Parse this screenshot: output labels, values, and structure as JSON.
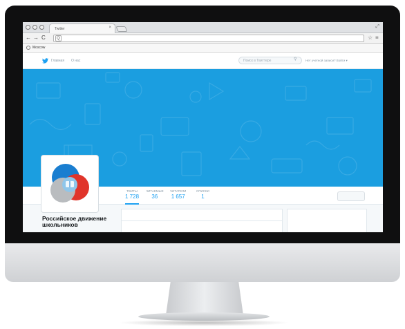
{
  "browser": {
    "tab_title": "Twitter",
    "tab_close": "×",
    "restore_glyph": "⤢",
    "nav": {
      "back": "←",
      "forward": "→",
      "reload": "C"
    },
    "omnibox_icon": "Q",
    "star": "☆",
    "menu": "≡",
    "bookmark_label": "Moscow"
  },
  "twitter": {
    "nav_home": "Главная",
    "nav_about": "О нас",
    "search_placeholder": "Поиск в Твиттере",
    "search_icon": "🔍",
    "login_prompt": "Нет учетной записи? Войти ▾",
    "brand_color": "#1da1f2",
    "banner_color": "#1b9ee0"
  },
  "profile": {
    "name": "Российское движение школьников",
    "stats": [
      {
        "label": "ТВИТЫ",
        "value": "1 728"
      },
      {
        "label": "ЧИТАЕМЫЕ",
        "value": "36"
      },
      {
        "label": "ЧИТАТЕЛИ",
        "value": "1 657"
      },
      {
        "label": "СПИСКИ",
        "value": "1"
      }
    ],
    "logo_colors": {
      "blue": "#1a7ed0",
      "red": "#e0342a",
      "grey": "#b9bcbf",
      "center": "#8fc6ea"
    }
  },
  "icons": {
    "bird": "twitter-bird-icon",
    "search": "search-icon",
    "star": "star-icon",
    "menu": "menu-icon",
    "globe": "globe-icon"
  }
}
